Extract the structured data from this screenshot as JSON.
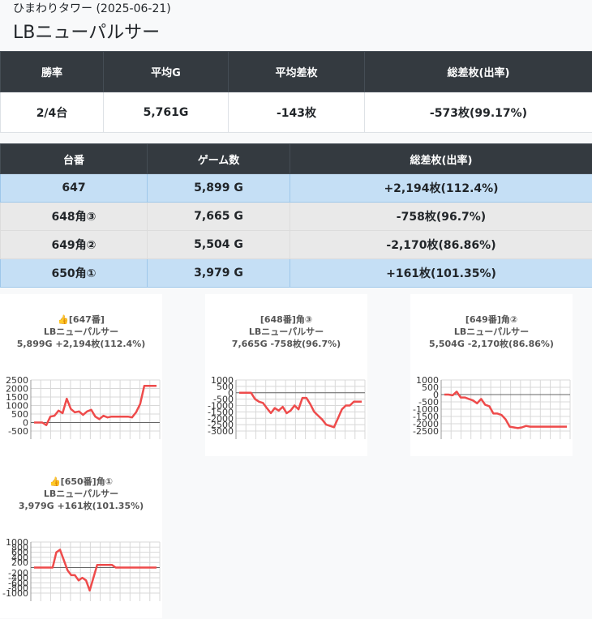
{
  "header": {
    "subtitle": "ひまわりタワー (2025-06-21)",
    "title": "LBニューパルサー"
  },
  "summary": {
    "headers": [
      "勝率",
      "平均G",
      "平均差枚",
      "総差枚(出率)"
    ],
    "values": [
      "2/4台",
      "5,761G",
      "-143枚",
      "-573枚(99.17%)"
    ]
  },
  "machines": {
    "headers": [
      "台番",
      "ゲーム数",
      "総差枚(出率)"
    ],
    "rows": [
      {
        "number": "647",
        "games": "5,899 G",
        "diff": "+2,194枚(112.4%)",
        "status": "plus"
      },
      {
        "number": "648角③",
        "games": "7,665 G",
        "diff": "-758枚(96.7%)",
        "status": "minus"
      },
      {
        "number": "649角②",
        "games": "5,504 G",
        "diff": "-2,170枚(86.86%)",
        "status": "minus"
      },
      {
        "number": "650角①",
        "games": "3,979 G",
        "diff": "+161枚(101.35%)",
        "status": "plus"
      }
    ]
  },
  "colors": {
    "line": "#ee4b4b",
    "grid": "#d8d8d8",
    "header_bg": "#343a40",
    "plus_row": "#c5dff5",
    "minus_row": "#e9e9e9"
  },
  "chart_data": [
    {
      "type": "line",
      "title_lines": [
        "👍[647番]",
        "LBニューパルサー",
        "5,899G +2,194枚(112.4%)"
      ],
      "ylim": [
        -500,
        2500
      ],
      "yticks": [
        -500,
        0,
        500,
        1000,
        1500,
        2000,
        2500
      ],
      "values": [
        0,
        0,
        0,
        -150,
        350,
        400,
        700,
        550,
        1400,
        800,
        600,
        650,
        450,
        650,
        750,
        350,
        200,
        400,
        300,
        350,
        350,
        350,
        350,
        350,
        300,
        600,
        1100,
        2150,
        2150,
        2150,
        2150
      ]
    },
    {
      "type": "line",
      "title_lines": [
        "[648番]角③",
        "LBニューパルサー",
        "7,665G -758枚(96.7%)"
      ],
      "ylim": [
        -3000,
        1000
      ],
      "yticks": [
        -3000,
        -2500,
        -2000,
        -1500,
        -1000,
        -500,
        0,
        500,
        1000
      ],
      "values": [
        0,
        0,
        0,
        0,
        -500,
        -700,
        -800,
        -1200,
        -1600,
        -1200,
        -1400,
        -1100,
        -1600,
        -1400,
        -1000,
        -1300,
        -400,
        -400,
        -900,
        -1500,
        -1800,
        -2100,
        -2500,
        -2600,
        -2700,
        -2000,
        -1300,
        -1000,
        -1000,
        -700,
        -700,
        -700
      ]
    },
    {
      "type": "line",
      "title_lines": [
        "[649番]角②",
        "LBニューパルサー",
        "5,504G -2,170枚(86.86%)"
      ],
      "ylim": [
        -2500,
        1000
      ],
      "yticks": [
        -2500,
        -2000,
        -1500,
        -1000,
        -500,
        0,
        500,
        1000
      ],
      "values": [
        0,
        0,
        -50,
        200,
        -200,
        -200,
        -300,
        -400,
        -600,
        -300,
        -700,
        -800,
        -1300,
        -1300,
        -1400,
        -1700,
        -2200,
        -2250,
        -2300,
        -2250,
        -2150,
        -2200,
        -2200,
        -2200,
        -2200,
        -2200,
        -2200,
        -2200,
        -2200,
        -2200,
        -2200
      ]
    },
    {
      "type": "line",
      "title_lines": [
        "👍[650番]角①",
        "LBニューパルサー",
        "3,979G +161枚(101.35%)"
      ],
      "ylim": [
        -1000,
        1000
      ],
      "yticks": [
        -1000,
        -800,
        -600,
        -400,
        -200,
        0,
        200,
        400,
        600,
        800,
        1000
      ],
      "ytick_labels": [
        "-1000",
        "-800",
        "-600",
        "-400",
        "-200",
        "",
        "200",
        "400",
        "600",
        "800",
        "1000"
      ],
      "values": [
        0,
        0,
        0,
        0,
        0,
        0,
        600,
        700,
        300,
        -100,
        -300,
        -300,
        -500,
        -400,
        -500,
        -900,
        -400,
        100,
        100,
        100,
        100,
        100,
        0,
        0,
        0,
        0,
        0,
        0,
        0,
        0,
        0,
        0,
        0,
        0
      ]
    }
  ]
}
